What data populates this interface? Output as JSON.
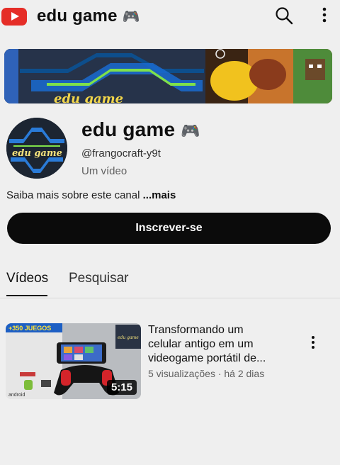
{
  "header": {
    "title": "edu game",
    "title_emoji": "🎮",
    "icons": [
      "youtube-logo-icon",
      "search-icon",
      "more-vert-icon"
    ]
  },
  "banner": {
    "text": "edu game"
  },
  "avatar": {
    "text": "edu game"
  },
  "channel": {
    "name": "edu game",
    "name_emoji": "🎮",
    "handle": "@frangocraft-y9t",
    "video_count": "Um vídeo",
    "about": "Saiba mais sobre este canal",
    "about_more": "...mais"
  },
  "subscribe": {
    "label": "Inscrever-se"
  },
  "tabs": [
    {
      "label": "Vídeos",
      "selected": true
    },
    {
      "label": "Pesquisar",
      "selected": false
    }
  ],
  "videos": [
    {
      "title_lines": [
        "Transformando um",
        "celular antigo em um",
        "videogame portátil de..."
      ],
      "meta": "5 visualizações · há 2 dias",
      "duration": "5:15",
      "thumbnail_badge": "+350 JUEGOS",
      "thumbnail_logo_text": "android",
      "thumbnail_channel_text": "edu game"
    }
  ],
  "colors": {
    "brand_red": "#e52d27",
    "subscribe_bg": "#0b0b0b",
    "background": "#efefef"
  }
}
